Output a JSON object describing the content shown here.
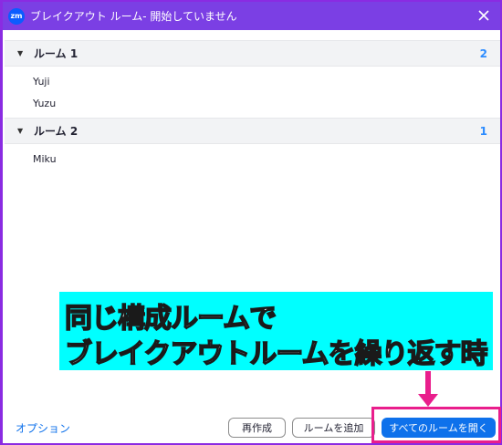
{
  "window": {
    "logo": "zm",
    "title": "ブレイクアウト ルーム- 開始していません",
    "close_icon": "close-icon"
  },
  "rooms": [
    {
      "name": "ルーム 1",
      "count": "2",
      "members": [
        "Yuji",
        "Yuzu"
      ]
    },
    {
      "name": "ルーム 2",
      "count": "1",
      "members": [
        "Miku"
      ]
    }
  ],
  "overlay": {
    "line1": "同じ構成ルームで",
    "line2": "ブレイクアウトルームを繰り返す時",
    "background": "#00ffff",
    "accent": "#e91e8c"
  },
  "footer": {
    "options_label": "オプション",
    "recreate_label": "再作成",
    "add_room_label": "ルームを追加",
    "open_all_label": "すべてのルームを開く"
  },
  "colors": {
    "titlebar": "#7b3fe4",
    "primary": "#0e71eb",
    "count": "#2d8cff"
  }
}
